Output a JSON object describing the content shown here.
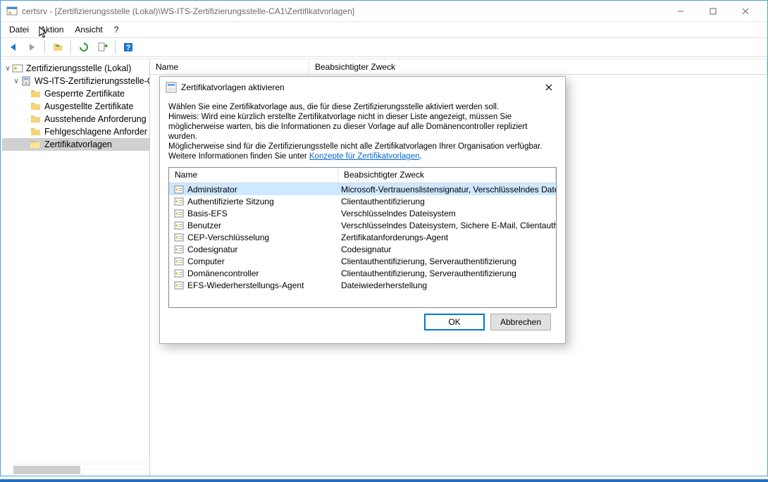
{
  "window": {
    "title": "certsrv - [Zertifizierungsstelle (Lokal)\\WS-ITS-Zertifizierungsstelle-CA1\\Zertifikatvorlagen]"
  },
  "menu": {
    "file": "Datei",
    "action": "Aktion",
    "view": "Ansicht",
    "help": "?"
  },
  "tree": {
    "root": "Zertifizierungsstelle (Lokal)",
    "ca": "WS-ITS-Zertifizierungsstelle-C",
    "nodes": {
      "revoked": "Gesperrte Zertifikate",
      "issued": "Ausgestellte Zertifikate",
      "pending": "Ausstehende Anforderung",
      "failed": "Fehlgeschlagene Anforder",
      "templates": "Zertifikatvorlagen"
    }
  },
  "list_header": {
    "name": "Name",
    "purpose": "Beabsichtigter Zweck"
  },
  "dialog": {
    "title": "Zertifikatvorlagen aktivieren",
    "instr1": "Wählen Sie eine Zertifikatvorlage aus, die für diese Zertifizierungsstelle aktiviert werden soll.",
    "instr2": "Hinweis: Wird eine kürzlich erstellte Zertifikatvorlage nicht in dieser Liste angezeigt, müssen Sie möglicherweise warten, bis die Informationen zu dieser Vorlage auf alle Domänencontroller repliziert wurden.",
    "instr3": "Möglicherweise sind für die Zertifizierungsstelle nicht alle Zertifikatvorlagen Ihrer Organisation verfügbar.",
    "link_pre": "Weitere Informationen finden Sie unter ",
    "link": "Konzepte für Zertifikatvorlagen",
    "link_post": ".",
    "cols": {
      "name": "Name",
      "purpose": "Beabsichtigter Zweck"
    },
    "rows": [
      {
        "name": "Administrator",
        "purpose": "Microsoft-Vertrauenslistensignatur, Verschlüsselndes Date"
      },
      {
        "name": "Authentifizierte Sitzung",
        "purpose": "Clientauthentifizierung"
      },
      {
        "name": "Basis-EFS",
        "purpose": "Verschlüsselndes Dateisystem"
      },
      {
        "name": "Benutzer",
        "purpose": "Verschlüsselndes Dateisystem, Sichere E-Mail, Clientauthe"
      },
      {
        "name": "CEP-Verschlüsselung",
        "purpose": "Zertifikatanforderungs-Agent"
      },
      {
        "name": "Codesignatur",
        "purpose": "Codesignatur"
      },
      {
        "name": "Computer",
        "purpose": "Clientauthentifizierung, Serverauthentifizierung"
      },
      {
        "name": "Domänencontroller",
        "purpose": "Clientauthentifizierung, Serverauthentifizierung"
      },
      {
        "name": "EFS-Wiederherstellungs-Agent",
        "purpose": "Dateiwiederherstellung"
      }
    ],
    "ok": "OK",
    "cancel": "Abbrechen"
  }
}
